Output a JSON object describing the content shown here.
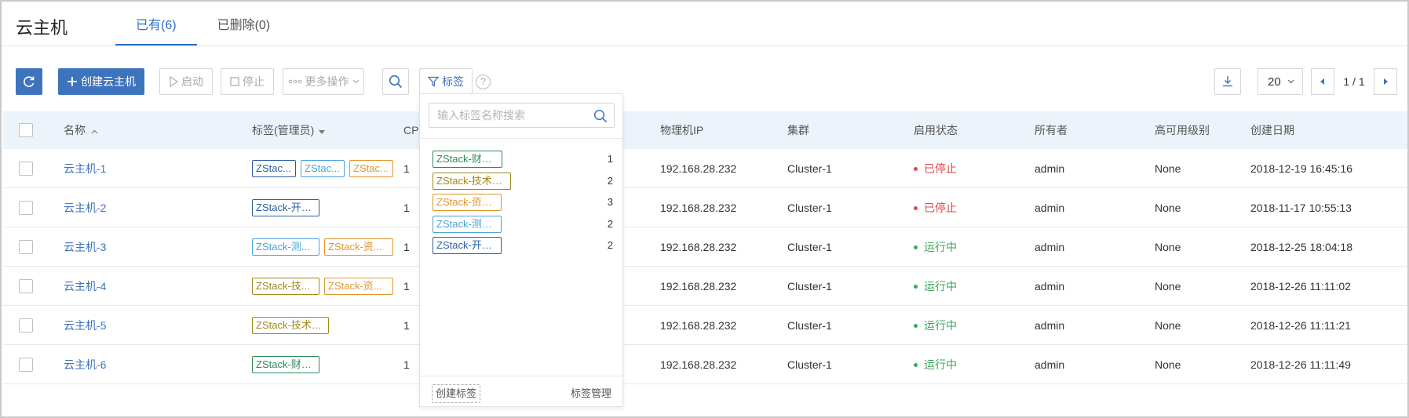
{
  "page": {
    "title": "云主机"
  },
  "tabs": [
    {
      "label": "已有(6)",
      "active": true
    },
    {
      "label": "已删除(0)",
      "active": false
    }
  ],
  "toolbar": {
    "refresh_icon": "refresh-icon",
    "create_label": "创建云主机",
    "start_label": "启动",
    "stop_label": "停止",
    "more_label": "更多操作",
    "search_icon": "search-icon",
    "tag_label": "标签",
    "help_text": "?"
  },
  "pagination": {
    "download_icon": "download-icon",
    "page_size": "20",
    "page_info": "1 / 1"
  },
  "table": {
    "headers": {
      "name": "名称",
      "tags": "标签(管理员)",
      "cpu": "CP",
      "ip": "物理机IP",
      "cluster": "集群",
      "state": "启用状态",
      "owner": "所有者",
      "ha": "高可用级别",
      "created": "创建日期"
    },
    "rows": [
      {
        "name": "云主机-1",
        "tags": [
          {
            "text": "ZStac...",
            "color": "#2a5f9e"
          },
          {
            "text": "ZStac...",
            "color": "#4aa3d8"
          },
          {
            "text": "ZStac...",
            "color": "#e0952c"
          }
        ],
        "cpu": "1",
        "ip": "192.168.28.232",
        "cluster": "Cluster-1",
        "state": "已停止",
        "state_color": "#e64545",
        "owner": "admin",
        "ha": "None",
        "created": "2018-12-19 16:45:16"
      },
      {
        "name": "云主机-2",
        "tags": [
          {
            "text": "ZStack-开发组",
            "color": "#2a5f9e"
          }
        ],
        "cpu": "1",
        "ip": "192.168.28.232",
        "cluster": "Cluster-1",
        "state": "已停止",
        "state_color": "#e64545",
        "owner": "admin",
        "ha": "None",
        "created": "2018-11-17 10:55:13"
      },
      {
        "name": "云主机-3",
        "tags": [
          {
            "text": "ZStack-测...",
            "color": "#4aa3d8"
          },
          {
            "text": "ZStack-资...",
            "color": "#e0952c"
          }
        ],
        "cpu": "1",
        "ip": "192.168.28.232",
        "cluster": "Cluster-1",
        "state": "运行中",
        "state_color": "#3aa757",
        "owner": "admin",
        "ha": "None",
        "created": "2018-12-25 18:04:18"
      },
      {
        "name": "云主机-4",
        "tags": [
          {
            "text": "ZStack-技...",
            "color": "#a08a1a"
          },
          {
            "text": "ZStack-资...",
            "color": "#e0952c"
          }
        ],
        "cpu": "1",
        "ip": "192.168.28.232",
        "cluster": "Cluster-1",
        "state": "运行中",
        "state_color": "#3aa757",
        "owner": "admin",
        "ha": "None",
        "created": "2018-12-26 11:11:02"
      },
      {
        "name": "云主机-5",
        "tags": [
          {
            "text": "ZStack-技术支持",
            "color": "#a08a1a"
          }
        ],
        "cpu": "1",
        "ip": "192.168.28.232",
        "cluster": "Cluster-1",
        "state": "运行中",
        "state_color": "#3aa757",
        "owner": "admin",
        "ha": "None",
        "created": "2018-12-26 11:11:21"
      },
      {
        "name": "云主机-6",
        "tags": [
          {
            "text": "ZStack-财务组",
            "color": "#2e8b57"
          }
        ],
        "cpu": "1",
        "ip": "192.168.28.232",
        "cluster": "Cluster-1",
        "state": "运行中",
        "state_color": "#3aa757",
        "owner": "admin",
        "ha": "None",
        "created": "2018-12-26 11:11:49"
      }
    ]
  },
  "tag_dropdown": {
    "search_placeholder": "输入标签名称搜索",
    "items": [
      {
        "label": "ZStack-财务组",
        "count": "1",
        "color": "#2e8b57"
      },
      {
        "label": "ZStack-技术支持",
        "count": "2",
        "color": "#a08a1a"
      },
      {
        "label": "ZStack-资料组",
        "count": "3",
        "color": "#e0952c"
      },
      {
        "label": "ZStack-测试组",
        "count": "2",
        "color": "#4aa3d8"
      },
      {
        "label": "ZStack-开发组",
        "count": "2",
        "color": "#2a5f9e"
      }
    ],
    "create_label": "创建标签",
    "manage_label": "标签管理"
  }
}
